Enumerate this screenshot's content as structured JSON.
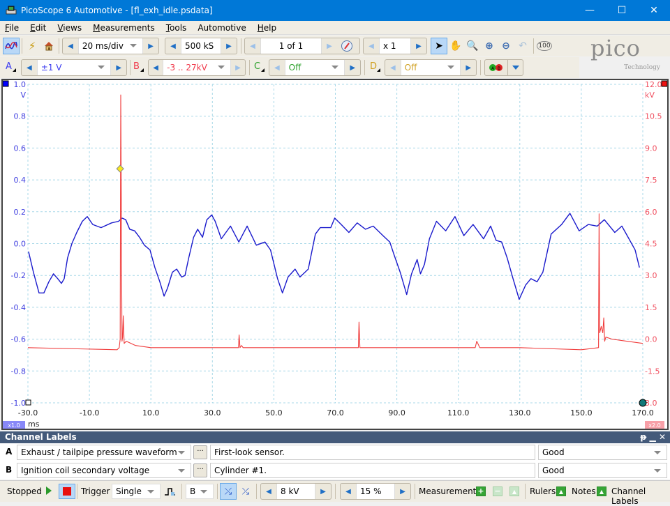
{
  "window": {
    "title": "PicoScope 6 Automotive - [fl_exh_idle.psdata]",
    "minimize": "—",
    "maximize": "☐",
    "close": "✕"
  },
  "menu": [
    {
      "label": "File",
      "u": "F",
      "rest": "ile"
    },
    {
      "label": "Edit",
      "u": "E",
      "rest": "dit"
    },
    {
      "label": "Views",
      "u": "V",
      "rest": "iews"
    },
    {
      "label": "Measurements",
      "u": "M",
      "rest": "easurements"
    },
    {
      "label": "Tools",
      "u": "T",
      "rest": "ools"
    },
    {
      "label": "Automotive",
      "u": "",
      "rest": "Automotive"
    },
    {
      "label": "Help",
      "u": "H",
      "rest": "elp"
    }
  ],
  "toolbar": {
    "timebase": "20 ms/div",
    "samples": "500 kS",
    "buffer": "1 of 1",
    "zoom": "x 1",
    "logo": "pico",
    "logo_sub": "Technology"
  },
  "channels": {
    "A": {
      "letter": "A",
      "range": "±1 V",
      "color": "#3a3af0"
    },
    "B": {
      "letter": "B",
      "range": "-3 .. 27kV",
      "color": "#f0384a"
    },
    "C": {
      "letter": "C",
      "range": "Off",
      "color": "#2aa02a"
    },
    "D": {
      "letter": "D",
      "range": "Off",
      "color": "#d0a020"
    }
  },
  "scope": {
    "unit_left": "V",
    "unit_right": "kV",
    "x_unit": "ms",
    "left_scale_badge": "x1.0",
    "right_scale_badge": "x2.0",
    "left_ticks": [
      "1.0",
      "0.8",
      "0.6",
      "0.4",
      "0.2",
      "0.0",
      "-0.2",
      "-0.4",
      "-0.6",
      "-0.8",
      "-1.0"
    ],
    "right_ticks": [
      "12.0",
      "10.5",
      "9.0",
      "7.5",
      "6.0",
      "4.5",
      "3.0",
      "1.5",
      "0.0",
      "-1.5",
      "3.0"
    ],
    "x_ticks": [
      "-30.0",
      "-10.0",
      "10.0",
      "30.0",
      "50.0",
      "70.0",
      "90.0",
      "110.0",
      "130.0",
      "150.0",
      "170.0"
    ]
  },
  "chart_data": {
    "type": "line",
    "title": "",
    "xlabel": "ms",
    "ylabel": "V",
    "y2label": "kV",
    "xlim": [
      -30,
      170
    ],
    "ylim": [
      -1.0,
      1.0
    ],
    "y2lim": [
      -3.0,
      12.0
    ],
    "grid": true,
    "series": [
      {
        "name": "A - Exhaust / tailpipe pressure waveform",
        "axis": "left",
        "color": "#1a1acc",
        "x": [
          -29.8,
          -28.2,
          -26.4,
          -24.8,
          -23.2,
          -21.7,
          -20.3,
          -19.1,
          -18.2,
          -17.1,
          -15.7,
          -14.1,
          -12.3,
          -10.7,
          -8.9,
          -6.2,
          -2.8,
          -0.5,
          0.6,
          1.8,
          3.1,
          4.7,
          6.3,
          7.9,
          9.7,
          11.3,
          12.9,
          14.3,
          15.4,
          17.0,
          18.4,
          20.0,
          21.1,
          22.3,
          23.9,
          25.2,
          26.8,
          28.2,
          29.8,
          30.9,
          32.9,
          35.9,
          38.6,
          41.3,
          44.3,
          47.1,
          48.9,
          51.2,
          52.8,
          54.6,
          56.9,
          58.5,
          61.2,
          63.5,
          65.1,
          68.5,
          69.8,
          71.9,
          74.4,
          77.1,
          79.8,
          82.3,
          85.5,
          87.7,
          89.1,
          91.1,
          93.2,
          94.8,
          96.6,
          97.7,
          99.0,
          100.6,
          102.9,
          105.9,
          108.9,
          111.8,
          114.8,
          118.2,
          120.5,
          122.3,
          124.1,
          125.9,
          127.8,
          129.8,
          131.9,
          133.6,
          135.6,
          137.5,
          140.2,
          143.6,
          146.3,
          149.3,
          152.3,
          155.2,
          157.5,
          160.9,
          163.2,
          165.5,
          167.5,
          168.9
        ],
        "y": [
          -0.05,
          -0.18,
          -0.31,
          -0.31,
          -0.24,
          -0.19,
          -0.22,
          -0.25,
          -0.22,
          -0.09,
          0.0,
          0.07,
          0.14,
          0.17,
          0.12,
          0.1,
          0.13,
          0.14,
          0.16,
          0.15,
          0.09,
          0.08,
          0.04,
          -0.01,
          -0.04,
          -0.15,
          -0.24,
          -0.33,
          -0.28,
          -0.18,
          -0.16,
          -0.21,
          -0.2,
          -0.09,
          0.04,
          0.09,
          0.04,
          0.15,
          0.18,
          0.14,
          0.03,
          0.11,
          0.01,
          0.11,
          -0.01,
          0.01,
          -0.04,
          -0.22,
          -0.31,
          -0.21,
          -0.16,
          -0.21,
          -0.16,
          0.06,
          0.1,
          0.1,
          0.16,
          0.12,
          0.07,
          0.13,
          0.09,
          0.11,
          0.05,
          0.01,
          -0.07,
          -0.18,
          -0.32,
          -0.19,
          -0.1,
          -0.19,
          -0.13,
          0.03,
          0.14,
          0.08,
          0.17,
          0.05,
          0.12,
          0.03,
          0.11,
          0.02,
          0.01,
          -0.09,
          -0.22,
          -0.35,
          -0.26,
          -0.22,
          -0.24,
          -0.18,
          0.06,
          0.12,
          0.19,
          0.08,
          0.12,
          0.11,
          0.15,
          0.07,
          0.11,
          0.03,
          -0.04,
          -0.15
        ]
      },
      {
        "name": "B - Ignition coil secondary voltage",
        "axis": "right",
        "color": "#f03c3c",
        "x": [
          -30,
          -1.0,
          -0.3,
          0.0,
          0.2,
          0.6,
          0.8,
          1.0,
          1.3,
          2.0,
          5.0,
          10.0,
          30.0,
          38.5,
          38.7,
          39.0,
          39.5,
          40.0,
          50.0,
          70.0,
          77.5,
          77.7,
          78.0,
          78.5,
          90.0,
          110.0,
          115.5,
          116.0,
          117.0,
          130.0,
          150.0,
          155.6,
          155.8,
          156.0,
          156.5,
          157.0,
          157.3,
          157.6,
          158.0,
          160.0,
          170.0
        ],
        "y": [
          -0.4,
          -0.5,
          -0.4,
          0.0,
          11.5,
          -0.1,
          0.1,
          1.1,
          -0.2,
          -0.1,
          -0.3,
          -0.4,
          -0.4,
          -0.4,
          0.2,
          -0.4,
          -0.3,
          -0.4,
          -0.4,
          -0.4,
          -0.4,
          0.8,
          -0.4,
          -0.4,
          -0.4,
          -0.4,
          -0.4,
          -0.1,
          -0.4,
          -0.4,
          -0.5,
          -0.4,
          5.9,
          0.3,
          0.6,
          0.3,
          1.0,
          -0.1,
          0.1,
          0.0,
          -0.2
        ]
      }
    ],
    "trigger_marker": {
      "x_ms": 0.0,
      "y_v": 0.47
    },
    "legend": "none"
  },
  "channel_labels": {
    "header": "Channel Labels",
    "rows": [
      {
        "channel": "A",
        "label": "Exhaust / tailpipe pressure waveform",
        "description": "First-look sensor.",
        "status": "Good"
      },
      {
        "channel": "B",
        "label": "Ignition coil secondary voltage",
        "description": "Cylinder #1.",
        "status": "Good"
      }
    ]
  },
  "statusbar": {
    "state": "Stopped",
    "trigger_label": "Trigger",
    "trigger_mode": "Single",
    "trigger_channel": "B",
    "trigger_level": "8 kV",
    "pretrigger": "15 %",
    "measurements": "Measurements",
    "rulers": "Rulers",
    "notes": "Notes",
    "channel_labels": "Channel Labels"
  }
}
